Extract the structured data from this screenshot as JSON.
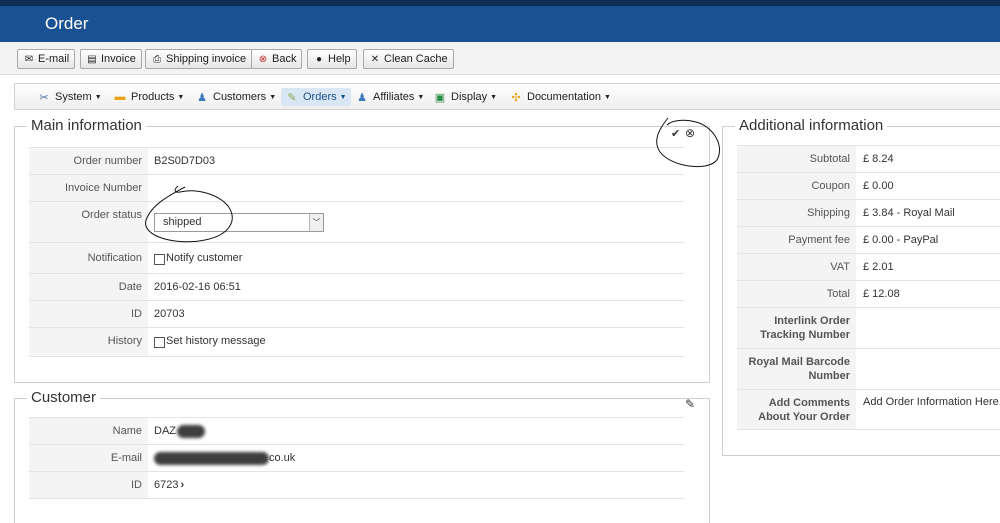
{
  "header": {
    "title": "Order"
  },
  "toolbar": {
    "email": "E-mail",
    "invoice": "Invoice",
    "shipping_invoice": "Shipping invoice",
    "back": "Back",
    "help": "Help",
    "clean_cache": "Clean Cache"
  },
  "menu": {
    "system": "System",
    "products": "Products",
    "customers": "Customers",
    "orders": "Orders",
    "affiliates": "Affiliates",
    "display": "Display",
    "documentation": "Documentation"
  },
  "main_info": {
    "legend": "Main information",
    "order_number_label": "Order number",
    "order_number": "B2S0D7D03",
    "invoice_number_label": "Invoice Number",
    "invoice_number": "",
    "order_status_label": "Order status",
    "order_status": "shipped",
    "notification_label": "Notification",
    "notify_customer": "Notify customer",
    "date_label": "Date",
    "date": "2016-02-16 06:51",
    "id_label": "ID",
    "id": "20703",
    "history_label": "History",
    "history_message": "Set history message"
  },
  "customer": {
    "legend": "Customer",
    "name_label": "Name",
    "name": "DAZ",
    "email_label": "E-mail",
    "email_suffix": "co.uk",
    "id_label": "ID",
    "id": "6723"
  },
  "additional": {
    "legend": "Additional information",
    "subtotal_label": "Subtotal",
    "subtotal": "£ 8.24",
    "coupon_label": "Coupon",
    "coupon": "£ 0.00",
    "shipping_label": "Shipping",
    "shipping": "£ 3.84 - Royal Mail",
    "payment_fee_label": "Payment fee",
    "payment_fee": "£ 0.00 - PayPal",
    "vat_label": "VAT",
    "vat": "£ 2.01",
    "total_label": "Total",
    "total": "£ 12.08",
    "interlink_label": "Interlink Order Tracking Number",
    "interlink": "",
    "royalmail_label": "Royal Mail Barcode Number",
    "royalmail": "",
    "comments_label": "Add Comments About Your Order",
    "comments": "Add Order Information Here..."
  },
  "icons": {
    "email": "envelope-icon",
    "invoice": "document-icon",
    "shipping_invoice": "printer-icon",
    "back": "back-icon",
    "help": "help-icon",
    "clean_cache": "broom-icon",
    "save": "check-icon",
    "cancel": "cancel-icon",
    "edit": "pencil-icon",
    "customer_link": "chevron-right-icon"
  },
  "colors": {
    "header_bg": "#1a5192",
    "top_strip": "#0f2e55",
    "active_menu": "#d9e6f4",
    "annotation": "#111111"
  }
}
